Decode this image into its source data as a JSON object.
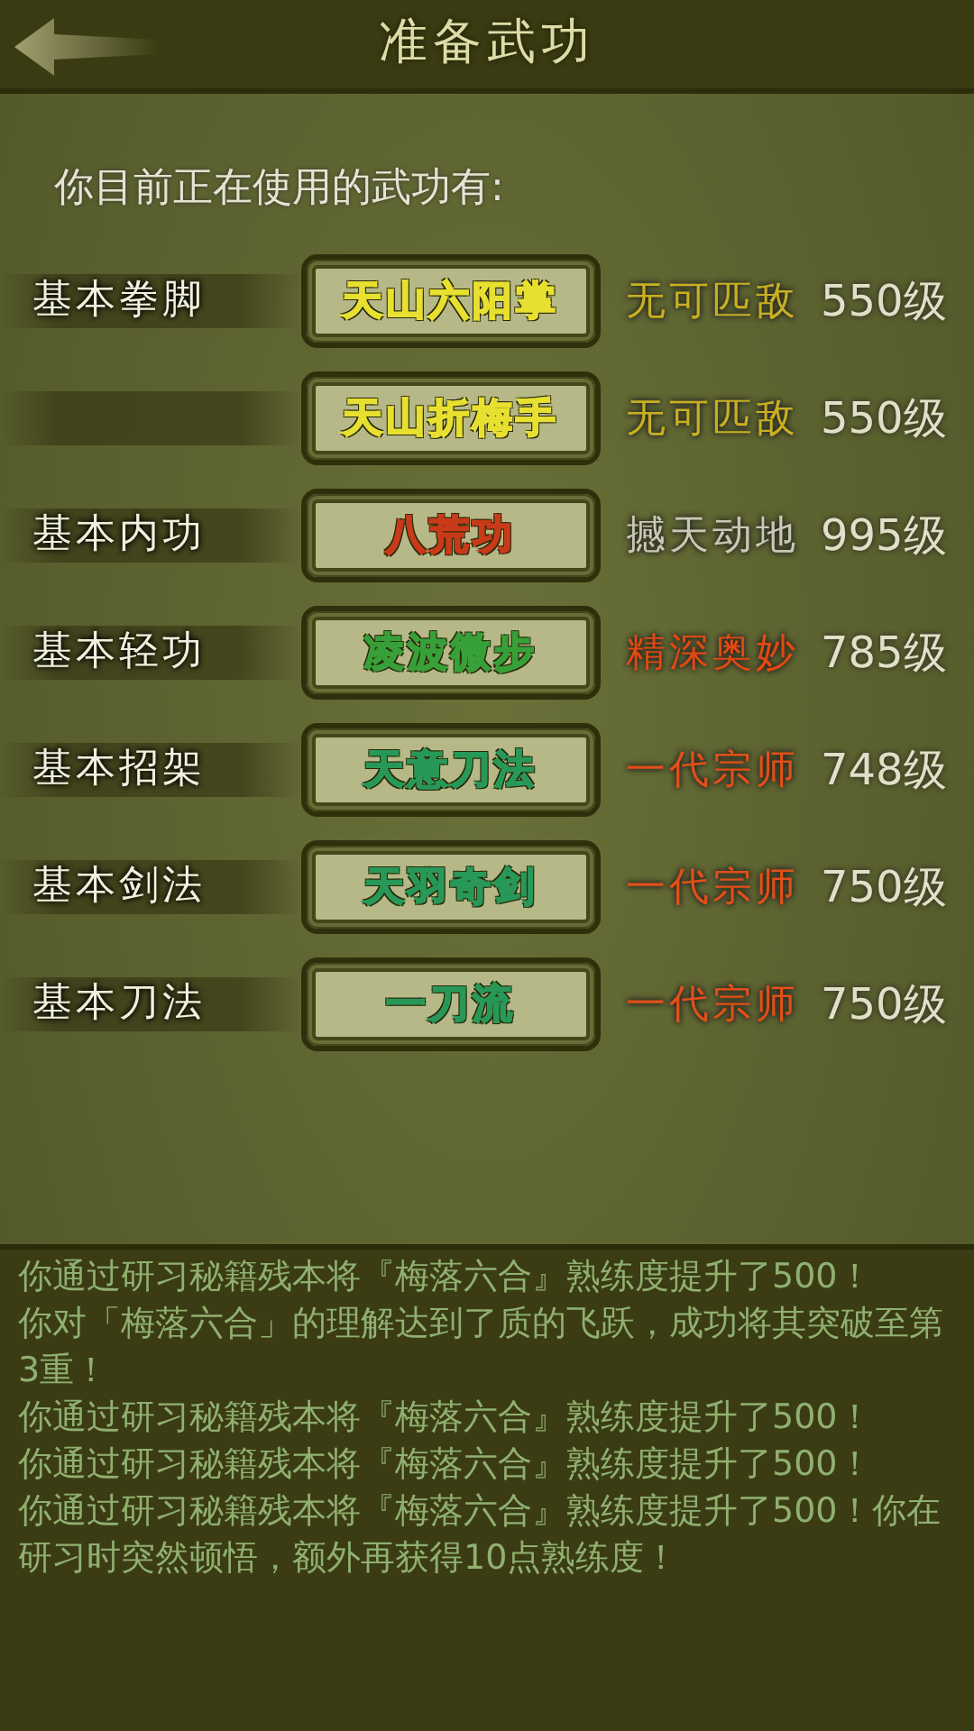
{
  "header": {
    "title": "准备武功"
  },
  "intro": "你目前正在使用的武功有:",
  "skills": [
    {
      "category": "基本拳脚",
      "name": {
        "text": "天山六阳掌",
        "color": "#e8e030"
      },
      "rank": {
        "text": "无可匹敌",
        "color": "#c8b020"
      },
      "level": "550级"
    },
    {
      "name": {
        "text": "天山折梅手",
        "color": "#e8e030"
      },
      "rank": {
        "text": "无可匹敌",
        "color": "#c8b020"
      },
      "level": "550级"
    },
    {
      "category": "基本内功",
      "name": {
        "text": "八荒功",
        "color": "#c83a18"
      },
      "rank": {
        "text": "撼天动地",
        "color": "#c8c8b4"
      },
      "level": "995级"
    },
    {
      "category": "基本轻功",
      "name": {
        "text": "凌波微步",
        "color": "#38a038"
      },
      "rank": {
        "text": "精深奥妙",
        "color": "#e04a10"
      },
      "level": "785级"
    },
    {
      "category": "基本招架",
      "name": {
        "text": "天意刀法",
        "color": "#289858"
      },
      "rank": {
        "text": "一代宗师",
        "color": "#e05018"
      },
      "level": "748级"
    },
    {
      "category": "基本剑法",
      "name": {
        "text": "天羽奇剑",
        "color": "#289858"
      },
      "rank": {
        "text": "一代宗师",
        "color": "#e05018"
      },
      "level": "750级"
    },
    {
      "category": "基本刀法",
      "name": {
        "text": "一刀流",
        "color": "#289858"
      },
      "rank": {
        "text": "一代宗师",
        "color": "#e05018"
      },
      "level": "750级"
    }
  ],
  "log": [
    "你通过研习秘籍残本将『梅落六合』熟练度提升了500！",
    "你对「梅落六合」的理解达到了质的飞跃，成功将其突破至第3重！",
    "你通过研习秘籍残本将『梅落六合』熟练度提升了500！",
    "你通过研习秘籍残本将『梅落六合』熟练度提升了500！",
    "你通过研习秘籍残本将『梅落六合』熟练度提升了500！你在研习时突然顿悟，额外再获得10点熟练度！"
  ]
}
